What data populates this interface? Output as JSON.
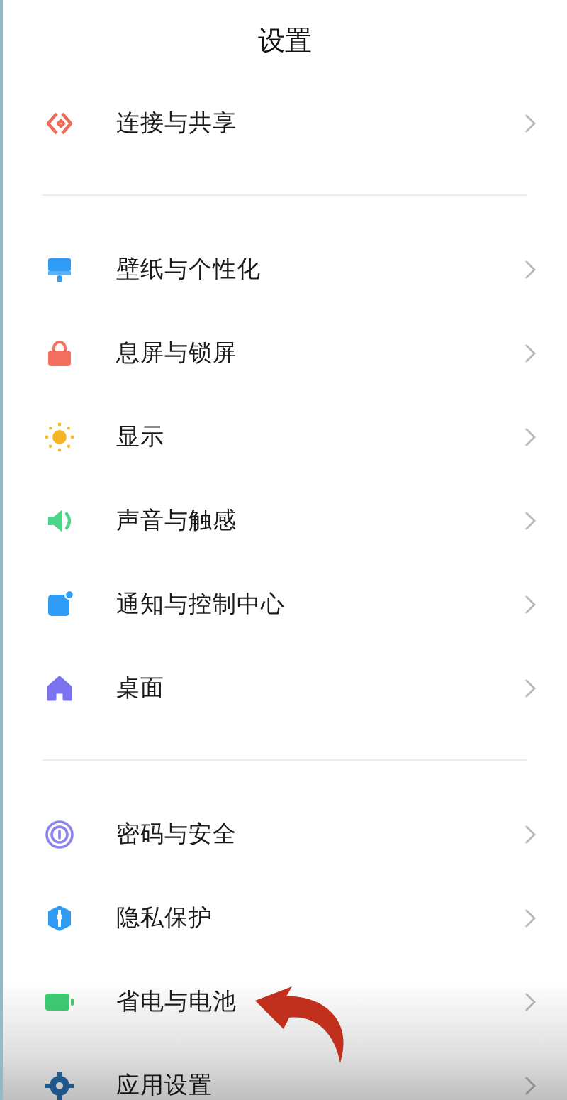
{
  "title": "设置",
  "sections": [
    {
      "items": [
        {
          "label": "连接与共享"
        }
      ]
    },
    {
      "items": [
        {
          "label": "壁纸与个性化"
        },
        {
          "label": "息屏与锁屏"
        },
        {
          "label": "显示"
        },
        {
          "label": "声音与触感"
        },
        {
          "label": "通知与控制中心"
        },
        {
          "label": "桌面"
        }
      ]
    },
    {
      "items": [
        {
          "label": "密码与安全"
        },
        {
          "label": "隐私保护"
        },
        {
          "label": "省电与电池"
        },
        {
          "label": "应用设置"
        }
      ]
    }
  ]
}
